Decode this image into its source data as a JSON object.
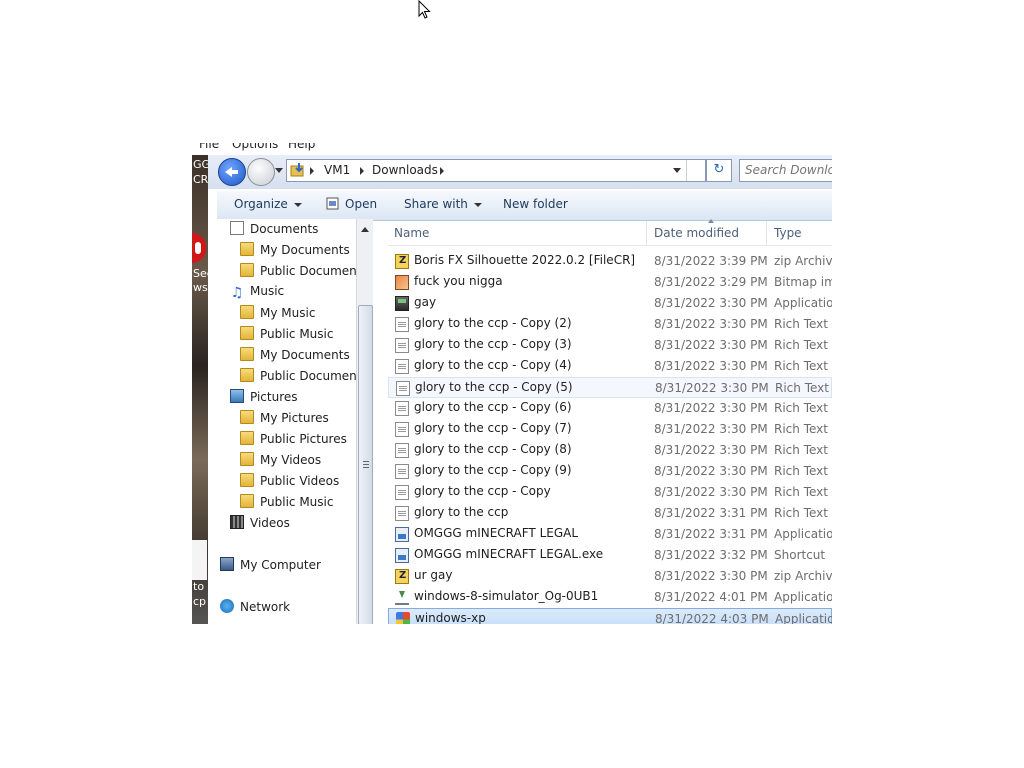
{
  "menubar": {
    "file": "File",
    "options": "Options",
    "help": "Help"
  },
  "address": {
    "segments": [
      "VM1",
      "Downloads"
    ]
  },
  "search": {
    "placeholder": "Search Downloads"
  },
  "toolbar": {
    "organize": "Organize",
    "open": "Open",
    "share_with": "Share with",
    "new_folder": "New folder"
  },
  "desktop_fragments": [
    "GG",
    "CR",
    "Sec",
    "wse",
    "to",
    "cp"
  ],
  "nav": {
    "items": [
      {
        "label": "Documents",
        "icon": "documents-library-icon",
        "indent": 1
      },
      {
        "label": "My Documents",
        "icon": "folder-icon",
        "indent": 2
      },
      {
        "label": "Public Documents",
        "icon": "folder-icon",
        "indent": 2
      },
      {
        "label": "Music",
        "icon": "music-library-icon",
        "indent": 1
      },
      {
        "label": "My Music",
        "icon": "folder-icon",
        "indent": 2
      },
      {
        "label": "Public Music",
        "icon": "folder-icon",
        "indent": 2
      },
      {
        "label": "My Documents",
        "icon": "folder-icon",
        "indent": 2
      },
      {
        "label": "Public Documents",
        "icon": "folder-icon",
        "indent": 2
      },
      {
        "label": "Pictures",
        "icon": "pictures-library-icon",
        "indent": 1
      },
      {
        "label": "My Pictures",
        "icon": "folder-icon",
        "indent": 2
      },
      {
        "label": "Public Pictures",
        "icon": "folder-icon",
        "indent": 2
      },
      {
        "label": "My Videos",
        "icon": "folder-icon",
        "indent": 2
      },
      {
        "label": "Public Videos",
        "icon": "folder-icon",
        "indent": 2
      },
      {
        "label": "Public Music",
        "icon": "folder-icon",
        "indent": 2
      },
      {
        "label": "Videos",
        "icon": "videos-library-icon",
        "indent": 1
      },
      {
        "label": "My Computer",
        "icon": "computer-icon",
        "indent": 0
      },
      {
        "label": "Network",
        "icon": "network-icon",
        "indent": 0
      }
    ]
  },
  "columns": {
    "name": "Name",
    "date": "Date modified",
    "type": "Type"
  },
  "files": [
    {
      "name": "Boris FX Silhouette 2022.0.2 [FileCR]",
      "date": "8/31/2022 3:39 PM",
      "type": "zip Archive",
      "icon": "zip-icon"
    },
    {
      "name": "fuck you nigga",
      "date": "8/31/2022 3:29 PM",
      "type": "Bitmap image",
      "icon": "bitmap-icon"
    },
    {
      "name": "gay",
      "date": "8/31/2022 3:30 PM",
      "type": "Application",
      "icon": "application-icon"
    },
    {
      "name": "glory to the ccp - Copy (2)",
      "date": "8/31/2022 3:30 PM",
      "type": "Rich Text Document",
      "icon": "document-icon"
    },
    {
      "name": "glory to the ccp - Copy (3)",
      "date": "8/31/2022 3:30 PM",
      "type": "Rich Text Document",
      "icon": "document-icon"
    },
    {
      "name": "glory to the ccp - Copy (4)",
      "date": "8/31/2022 3:30 PM",
      "type": "Rich Text Document",
      "icon": "document-icon"
    },
    {
      "name": "glory to the ccp - Copy (5)",
      "date": "8/31/2022 3:30 PM",
      "type": "Rich Text Document",
      "icon": "document-icon"
    },
    {
      "name": "glory to the ccp - Copy (6)",
      "date": "8/31/2022 3:30 PM",
      "type": "Rich Text Document",
      "icon": "document-icon"
    },
    {
      "name": "glory to the ccp - Copy (7)",
      "date": "8/31/2022 3:30 PM",
      "type": "Rich Text Document",
      "icon": "document-icon"
    },
    {
      "name": "glory to the ccp - Copy (8)",
      "date": "8/31/2022 3:30 PM",
      "type": "Rich Text Document",
      "icon": "document-icon"
    },
    {
      "name": "glory to the ccp - Copy (9)",
      "date": "8/31/2022 3:30 PM",
      "type": "Rich Text Document",
      "icon": "document-icon"
    },
    {
      "name": "glory to the ccp - Copy",
      "date": "8/31/2022 3:30 PM",
      "type": "Rich Text Document",
      "icon": "document-icon"
    },
    {
      "name": "glory to the ccp",
      "date": "8/31/2022 3:31 PM",
      "type": "Rich Text Document",
      "icon": "document-icon"
    },
    {
      "name": "OMGGG mINECRAFT LEGAL",
      "date": "8/31/2022 3:31 PM",
      "type": "Application",
      "icon": "java-app-icon"
    },
    {
      "name": "OMGGG mINECRAFT LEGAL.exe",
      "date": "8/31/2022 3:32 PM",
      "type": "Shortcut",
      "icon": "shortcut-icon"
    },
    {
      "name": "ur gay",
      "date": "8/31/2022 3:30 PM",
      "type": "zip Archive",
      "icon": "zip-icon"
    },
    {
      "name": "windows-8-simulator_Og-0UB1",
      "date": "8/31/2022 4:01 PM",
      "type": "Application",
      "icon": "download-icon"
    },
    {
      "name": "windows-xp",
      "date": "8/31/2022 4:03 PM",
      "type": "Application",
      "icon": "windows-xp-icon"
    }
  ],
  "hover_row": 6,
  "selected_row": 17
}
